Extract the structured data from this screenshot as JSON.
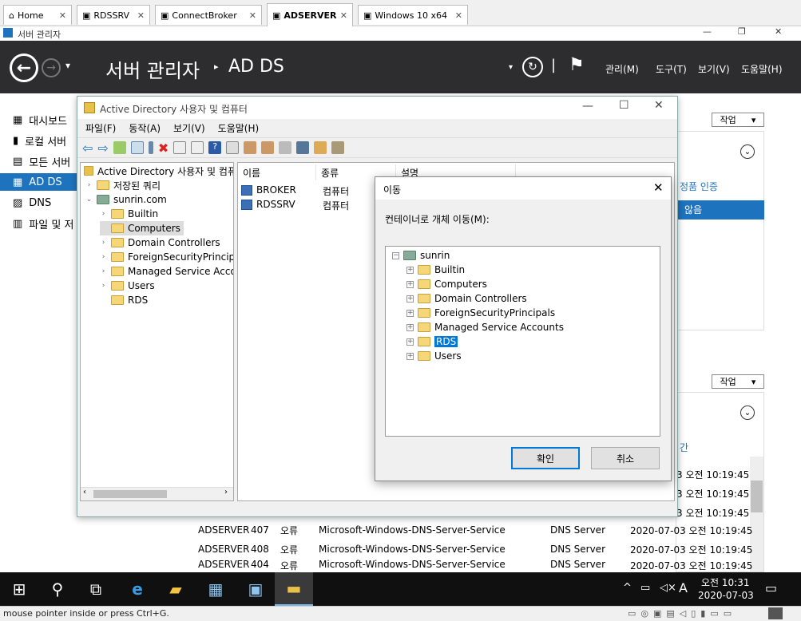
{
  "vm_tabs": [
    {
      "label": "Home",
      "icon": "home-icon"
    },
    {
      "label": "RDSSRV",
      "icon": "vm-icon"
    },
    {
      "label": "ConnectBroker",
      "icon": "vm-icon"
    },
    {
      "label": "ADSERVER",
      "icon": "vm-icon",
      "active": true
    },
    {
      "label": "Windows 10 x64",
      "icon": "vm-icon"
    }
  ],
  "server_manager": {
    "window_title": "서버 관리자",
    "breadcrumb_root": "서버 관리자",
    "breadcrumb_current": "AD DS",
    "menus": [
      "관리(M)",
      "도구(T)",
      "보기(V)",
      "도움말(H)"
    ],
    "nav_items": [
      {
        "label": "대시보드",
        "icon": "dashboard-icon"
      },
      {
        "label": "로컬 서버",
        "icon": "server-icon"
      },
      {
        "label": "모든 서버",
        "icon": "servers-icon"
      },
      {
        "label": "AD DS",
        "icon": "adds-icon",
        "selected": true
      },
      {
        "label": "DNS",
        "icon": "dns-icon"
      },
      {
        "label": "파일 및 저",
        "icon": "file-icon"
      }
    ],
    "tasks_label": "작업",
    "activation_label": "정품 인증",
    "activation_value": "않음",
    "time_column_label": "간",
    "events": [
      {
        "server": "ADSERVER",
        "id": "407",
        "level": "오류",
        "source": "Microsoft-Windows-DNS-Server-Service",
        "log": "DNS Server",
        "time": "2020-07-03 오전 10:19:45"
      },
      {
        "server": "ADSERVER",
        "id": "408",
        "level": "오류",
        "source": "Microsoft-Windows-DNS-Server-Service",
        "log": "DNS Server",
        "time": "2020-07-03 오전 10:19:45"
      },
      {
        "server": "ADSERVER",
        "id": "404",
        "level": "오류",
        "source": "Microsoft-Windows-DNS-Server-Service",
        "log": "DNS Server",
        "time": "2020-07-03 오전 10:19:45"
      }
    ],
    "right_times": [
      "3 오전 10:19:45",
      "3 오전 10:19:45",
      "3 오전 10:19:45"
    ]
  },
  "aduc": {
    "title": "Active Directory 사용자 및 컴퓨터",
    "menus": [
      "파일(F)",
      "동작(A)",
      "보기(V)",
      "도움말(H)"
    ],
    "tree_root": "Active Directory 사용자 및 컴퓨",
    "tree": [
      {
        "label": "저장된 쿼리",
        "level": 1
      },
      {
        "label": "sunrin.com",
        "level": 1
      },
      {
        "label": "Builtin",
        "level": 2
      },
      {
        "label": "Computers",
        "level": 2,
        "selected": true
      },
      {
        "label": "Domain Controllers",
        "level": 2
      },
      {
        "label": "ForeignSecurityPrincipals",
        "level": 2
      },
      {
        "label": "Managed Service Accou",
        "level": 2
      },
      {
        "label": "Users",
        "level": 2
      },
      {
        "label": "RDS",
        "level": 2
      }
    ],
    "columns": [
      "이름",
      "종류",
      "설명"
    ],
    "rows": [
      {
        "name": "BROKER",
        "type": "컴퓨터"
      },
      {
        "name": "RDSSRV",
        "type": "컴퓨터"
      }
    ]
  },
  "move_dialog": {
    "title": "이동",
    "prompt": "컨테이너로 개체 이동(M):",
    "root": "sunrin",
    "items": [
      "Builtin",
      "Computers",
      "Domain Controllers",
      "ForeignSecurityPrincipals",
      "Managed Service Accounts",
      "RDS",
      "Users"
    ],
    "selected": "RDS",
    "ok_label": "확인",
    "cancel_label": "취소"
  },
  "taskbar": {
    "time": "오전 10:31",
    "date": "2020-07-03",
    "ime": "A"
  },
  "status_text": "mouse pointer inside or press Ctrl+G."
}
